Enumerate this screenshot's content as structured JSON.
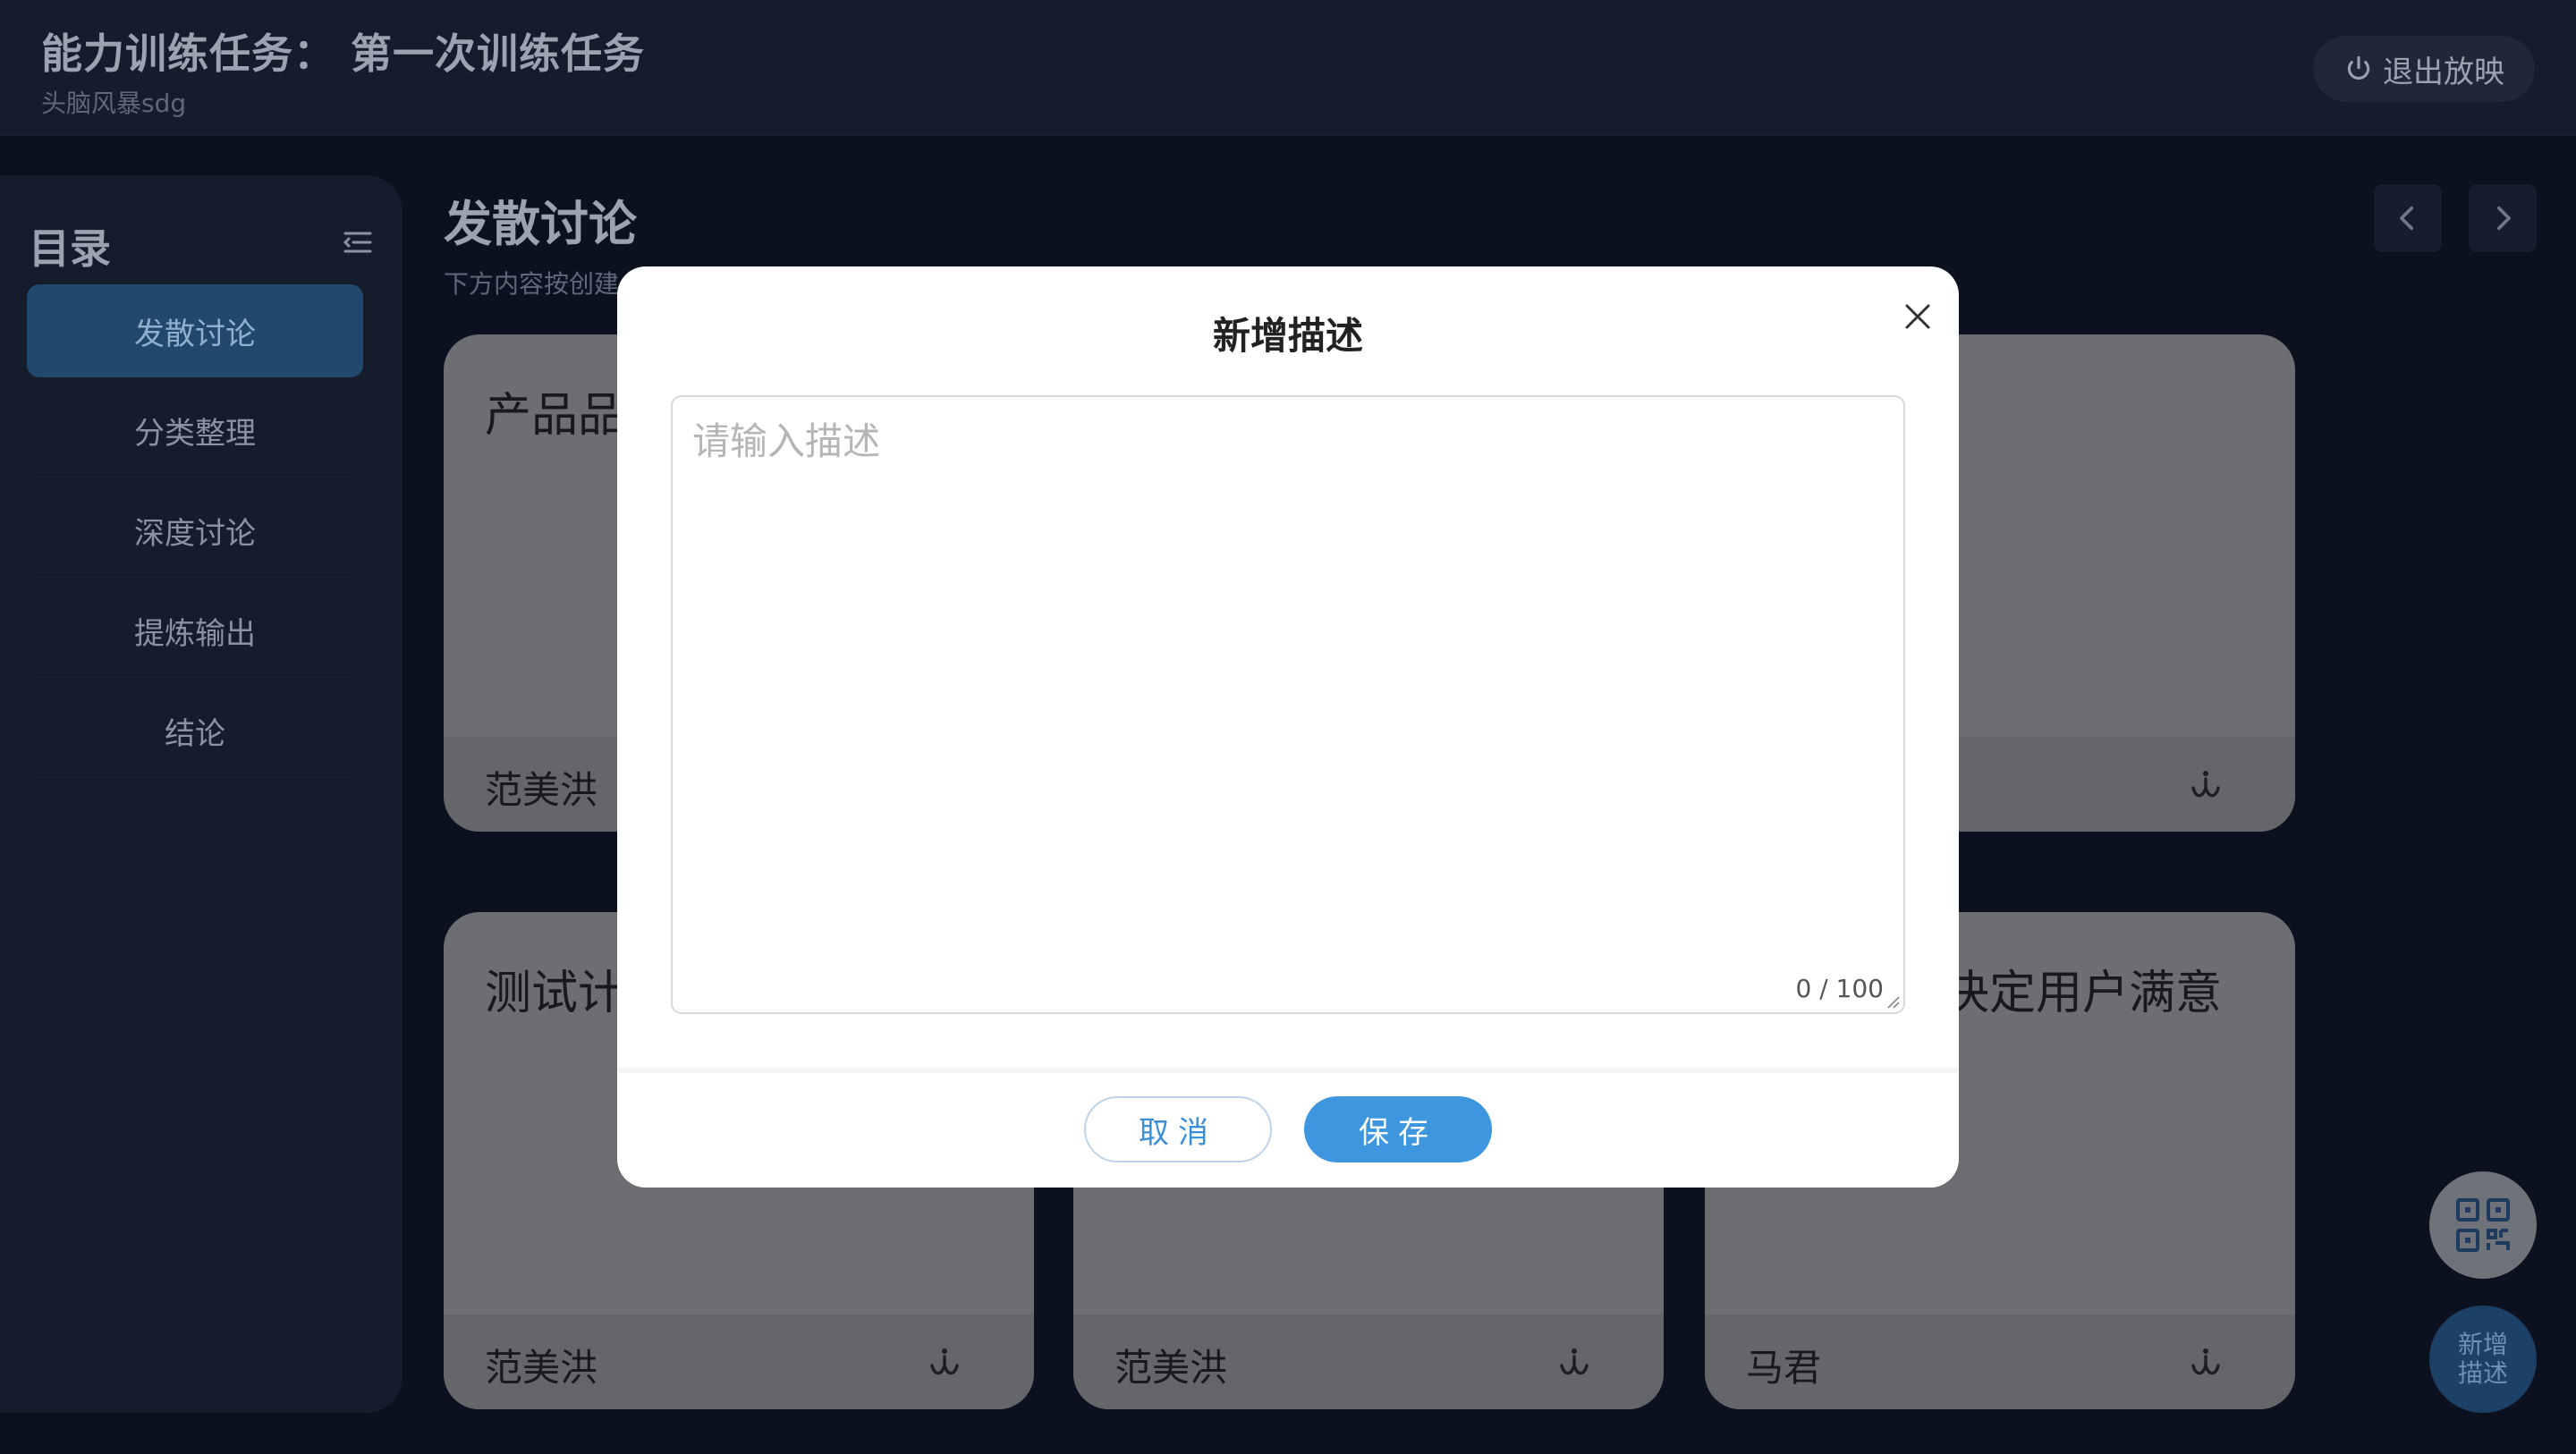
{
  "header": {
    "task_title": "能力训练任务：  第一次训练任务",
    "task_subtitle": "头脑风暴sdg",
    "exit_label": "退出放映",
    "exit_icon": "power-icon"
  },
  "sidebar": {
    "title": "目录",
    "menu_icon": "menu-collapse-icon",
    "items": [
      {
        "label": "发散讨论",
        "active": true
      },
      {
        "label": "分类整理",
        "active": false
      },
      {
        "label": "深度讨论",
        "active": false
      },
      {
        "label": "提炼输出",
        "active": false
      },
      {
        "label": "结论",
        "active": false
      }
    ]
  },
  "main": {
    "title": "发散讨论",
    "subtitle": "下方内容按创建",
    "prev_icon": "chevron-left-icon",
    "next_icon": "chevron-right-icon",
    "cards": [
      {
        "title": "产品品",
        "author": "范美洪"
      },
      {
        "title": "",
        "author": ""
      },
      {
        "title": "",
        "author": ""
      },
      {
        "title": "测试计",
        "author": "范美洪"
      },
      {
        "title": "",
        "author": "范美洪"
      },
      {
        "title": "决定用户满意",
        "author": "马君"
      }
    ]
  },
  "floating": {
    "qr_icon": "qr-code-icon",
    "add_line1": "新增",
    "add_line2": "描述"
  },
  "modal": {
    "title": "新增描述",
    "placeholder": "请输入描述",
    "value": "",
    "char_count": "0 / 100",
    "cancel_label": "取消",
    "save_label": "保存",
    "close_icon": "close-icon"
  },
  "colors": {
    "accent": "#3d96de",
    "background": "#0c1120",
    "panel": "#151c2b"
  }
}
